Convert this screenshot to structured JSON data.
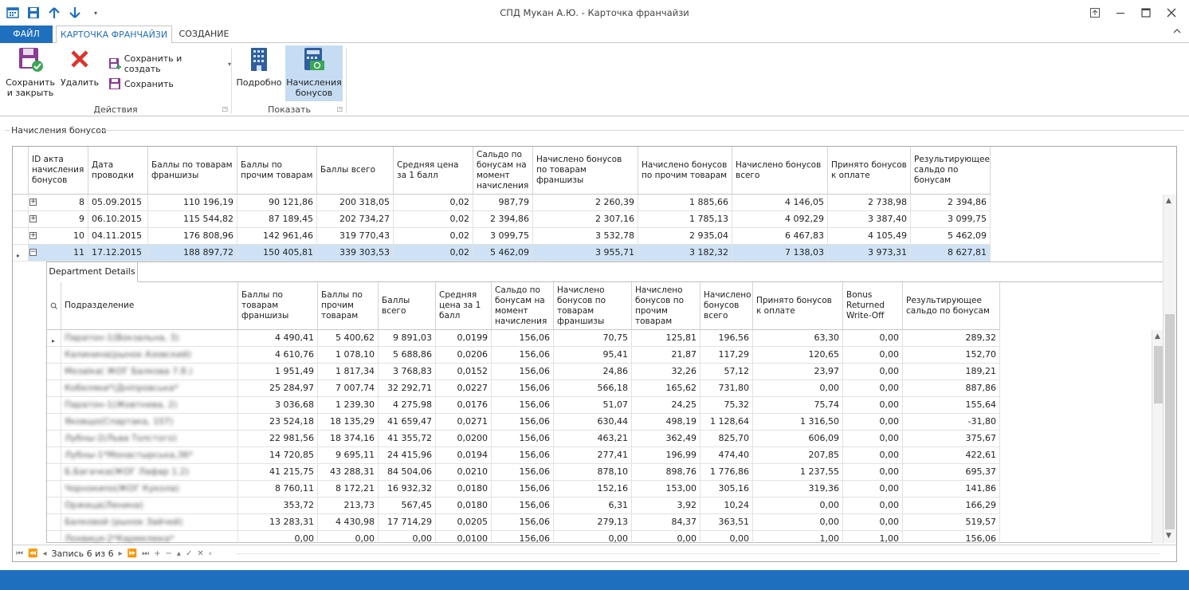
{
  "window": {
    "title": "СПД Мукан А.Ю. - Карточка франчайзи"
  },
  "tabs": {
    "file": "ФАЙЛ",
    "card": "КАРТОЧКА ФРАНЧАЙЗИ",
    "create": "СОЗДАНИЕ"
  },
  "ribbon": {
    "actions": {
      "save_close_1": "Сохранить",
      "save_close_2": "и закрыть",
      "delete": "Удалить",
      "save_create": "Сохранить и создать",
      "save": "Сохранить",
      "group_label": "Действия"
    },
    "show": {
      "detail": "Подробно",
      "bonus_1": "Начисления",
      "bonus_2": "бонусов",
      "group_label": "Показать"
    }
  },
  "panel_title": "Начисления бонусов",
  "main_grid": {
    "headers": [
      "ID акта начисления бонусов",
      "Дата проводки",
      "Баллы по товарам франшизы",
      "Баллы по прочим товарам",
      "Баллы всего",
      "Средняя цена за 1 балл",
      "Сальдо по бонусам на момент начисления",
      "Начислено бонусов по товарам франшизы",
      "Начислено бонусов по прочим товарам",
      "Начислено бонусов всего",
      "Принято бонусов к оплате",
      "Результирующее сальдо по бонусам"
    ],
    "rows": [
      [
        "8",
        "05.09.2015",
        "110 196,19",
        "90 121,86",
        "200 318,05",
        "0,02",
        "987,79",
        "2 260,39",
        "1 885,66",
        "4 146,05",
        "2 738,98",
        "2 394,86"
      ],
      [
        "9",
        "06.10.2015",
        "115 544,82",
        "87 189,45",
        "202 734,27",
        "0,02",
        "2 394,86",
        "2 307,16",
        "1 785,13",
        "4 092,29",
        "3 387,40",
        "3 099,75"
      ],
      [
        "10",
        "04.11.2015",
        "176 808,96",
        "142 961,46",
        "319 770,43",
        "0,02",
        "3 099,75",
        "3 532,78",
        "2 935,04",
        "6 467,83",
        "4 105,49",
        "5 462,09"
      ],
      [
        "11",
        "17.12.2015",
        "188 897,72",
        "150 405,81",
        "339 303,53",
        "0,02",
        "5 462,09",
        "3 955,71",
        "3 182,32",
        "7 138,03",
        "3 973,31",
        "8 627,81"
      ]
    ]
  },
  "detail": {
    "tab": "Department Details",
    "headers": [
      "Подразделение",
      "Баллы по товарам франшизы",
      "Баллы по прочим товарам",
      "Баллы всего",
      "Средняя цена за 1 балл",
      "Сальдо по бонусам на момент начисления",
      "Начислено бонусов по товарам франшизы",
      "Начислено бонусов по прочим товарам",
      "Начислено бонусов всего",
      "Принято бонусов к оплате",
      "Bonus Returned Write-Off",
      "Результирующее сальдо по бонусам"
    ],
    "rows": [
      [
        "Паратон-1(Вокзальна, 3)",
        "4 490,41",
        "5 400,62",
        "9 891,03",
        "0,0199",
        "156,06",
        "70,75",
        "125,81",
        "196,56",
        "63,30",
        "0,00",
        "289,32"
      ],
      [
        "Калинина(рынок Азовский)",
        "4 610,76",
        "1 078,10",
        "5 688,86",
        "0,0206",
        "156,06",
        "95,41",
        "21,87",
        "117,29",
        "120,65",
        "0,00",
        "152,70"
      ],
      [
        "Мозаїка( ЖОГ Балкова 7.8.)",
        "1 951,49",
        "1 817,34",
        "3 768,83",
        "0,0152",
        "156,06",
        "24,86",
        "32,26",
        "57,12",
        "23,97",
        "0,00",
        "189,21"
      ],
      [
        "Кобеляки*(Дніпровська*",
        "25 284,97",
        "7 007,74",
        "32 292,71",
        "0,0227",
        "156,06",
        "566,18",
        "165,62",
        "731,80",
        "0,00",
        "0,00",
        "887,86"
      ],
      [
        "Паратон-1(Жовтнева, 2)",
        "3 036,68",
        "1 239,30",
        "4 275,98",
        "0,0176",
        "156,06",
        "51,07",
        "24,25",
        "75,32",
        "75,74",
        "0,00",
        "155,64"
      ],
      [
        "Яковщо(Спартака, 107)",
        "23 524,18",
        "18 135,29",
        "41 659,47",
        "0,0271",
        "156,06",
        "630,44",
        "498,19",
        "1 128,64",
        "1 316,50",
        "0,00",
        "-31,80"
      ],
      [
        "Лубны-2(Льва Толстого)",
        "22 981,56",
        "18 374,16",
        "41 355,72",
        "0,0200",
        "156,06",
        "463,21",
        "362,49",
        "825,70",
        "606,09",
        "0,00",
        "375,67"
      ],
      [
        "Лубны-1*Монастырська,36*",
        "14 720,85",
        "9 695,11",
        "24 415,96",
        "0,0194",
        "156,06",
        "277,41",
        "196,99",
        "474,40",
        "207,85",
        "0,00",
        "422,61"
      ],
      [
        "Б.Багачка(ЖОГ Лафар 1.2)",
        "41 215,75",
        "43 288,31",
        "84 504,06",
        "0,0210",
        "156,06",
        "878,10",
        "898,76",
        "1 776,86",
        "1 237,55",
        "0,00",
        "695,37"
      ],
      [
        "Чорнокипо(ЖОГ Кукола)",
        "8 760,11",
        "8 172,21",
        "16 932,32",
        "0,0180",
        "156,06",
        "152,16",
        "153,00",
        "305,16",
        "319,36",
        "0,00",
        "141,86"
      ],
      [
        "Оржица(Ленина)",
        "353,72",
        "213,73",
        "567,45",
        "0,0180",
        "156,06",
        "6,31",
        "3,92",
        "10,24",
        "0,00",
        "0,00",
        "166,29"
      ],
      [
        "Балковой (рынок Зайчей)",
        "13 283,31",
        "4 430,98",
        "17 714,29",
        "0,0205",
        "156,06",
        "279,13",
        "84,37",
        "363,51",
        "0,00",
        "0,00",
        "519,57"
      ],
      [
        "Лохвиця-2*Кармелюка*",
        "0,00",
        "0,00",
        "0,00",
        "0,0100",
        "156,06",
        "0,00",
        "0,00",
        "0,00",
        "1,00",
        "1,00",
        "156,06"
      ]
    ]
  },
  "navigator": {
    "record": "Запись 6 из 6"
  },
  "colors": {
    "accent": "#1f6fbf",
    "selection": "#cfe2f5"
  }
}
